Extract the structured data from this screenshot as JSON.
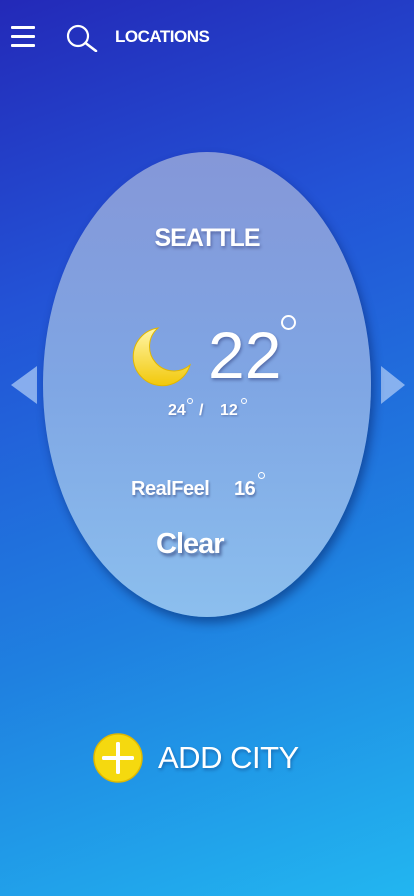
{
  "header": {
    "menu_icon": "hamburger-menu-icon",
    "search_icon": "search-icon",
    "locations_label": "LOCATIONS"
  },
  "weather": {
    "city": "SEATTLE",
    "condition_icon": "moon-icon",
    "temperature": "22",
    "high": "24",
    "separator": "/",
    "low": "12",
    "realfeel_label": "RealFeel",
    "realfeel_value": "16",
    "condition": "Clear"
  },
  "navigation": {
    "prev_icon": "arrow-left-icon",
    "next_icon": "arrow-right-icon"
  },
  "add_city": {
    "icon": "plus-circle-icon",
    "label": "ADD CITY"
  },
  "colors": {
    "accent_yellow": "#f5d90f",
    "text": "#ffffff",
    "background_top": "#2329b8",
    "background_bottom": "#22b6f0"
  }
}
